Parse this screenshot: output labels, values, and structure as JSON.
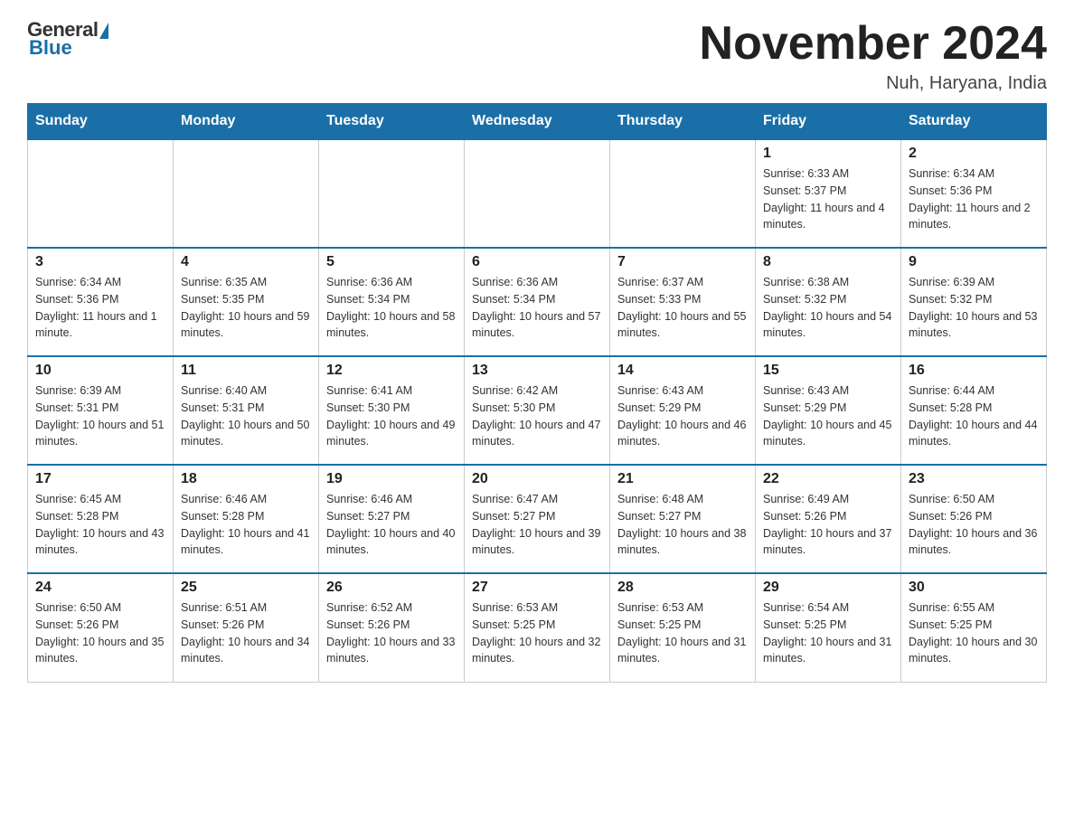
{
  "logo": {
    "general": "General",
    "blue": "Blue"
  },
  "title": "November 2024",
  "location": "Nuh, Haryana, India",
  "weekdays": [
    "Sunday",
    "Monday",
    "Tuesday",
    "Wednesday",
    "Thursday",
    "Friday",
    "Saturday"
  ],
  "weeks": [
    [
      {
        "day": "",
        "info": ""
      },
      {
        "day": "",
        "info": ""
      },
      {
        "day": "",
        "info": ""
      },
      {
        "day": "",
        "info": ""
      },
      {
        "day": "",
        "info": ""
      },
      {
        "day": "1",
        "info": "Sunrise: 6:33 AM\nSunset: 5:37 PM\nDaylight: 11 hours and 4 minutes."
      },
      {
        "day": "2",
        "info": "Sunrise: 6:34 AM\nSunset: 5:36 PM\nDaylight: 11 hours and 2 minutes."
      }
    ],
    [
      {
        "day": "3",
        "info": "Sunrise: 6:34 AM\nSunset: 5:36 PM\nDaylight: 11 hours and 1 minute."
      },
      {
        "day": "4",
        "info": "Sunrise: 6:35 AM\nSunset: 5:35 PM\nDaylight: 10 hours and 59 minutes."
      },
      {
        "day": "5",
        "info": "Sunrise: 6:36 AM\nSunset: 5:34 PM\nDaylight: 10 hours and 58 minutes."
      },
      {
        "day": "6",
        "info": "Sunrise: 6:36 AM\nSunset: 5:34 PM\nDaylight: 10 hours and 57 minutes."
      },
      {
        "day": "7",
        "info": "Sunrise: 6:37 AM\nSunset: 5:33 PM\nDaylight: 10 hours and 55 minutes."
      },
      {
        "day": "8",
        "info": "Sunrise: 6:38 AM\nSunset: 5:32 PM\nDaylight: 10 hours and 54 minutes."
      },
      {
        "day": "9",
        "info": "Sunrise: 6:39 AM\nSunset: 5:32 PM\nDaylight: 10 hours and 53 minutes."
      }
    ],
    [
      {
        "day": "10",
        "info": "Sunrise: 6:39 AM\nSunset: 5:31 PM\nDaylight: 10 hours and 51 minutes."
      },
      {
        "day": "11",
        "info": "Sunrise: 6:40 AM\nSunset: 5:31 PM\nDaylight: 10 hours and 50 minutes."
      },
      {
        "day": "12",
        "info": "Sunrise: 6:41 AM\nSunset: 5:30 PM\nDaylight: 10 hours and 49 minutes."
      },
      {
        "day": "13",
        "info": "Sunrise: 6:42 AM\nSunset: 5:30 PM\nDaylight: 10 hours and 47 minutes."
      },
      {
        "day": "14",
        "info": "Sunrise: 6:43 AM\nSunset: 5:29 PM\nDaylight: 10 hours and 46 minutes."
      },
      {
        "day": "15",
        "info": "Sunrise: 6:43 AM\nSunset: 5:29 PM\nDaylight: 10 hours and 45 minutes."
      },
      {
        "day": "16",
        "info": "Sunrise: 6:44 AM\nSunset: 5:28 PM\nDaylight: 10 hours and 44 minutes."
      }
    ],
    [
      {
        "day": "17",
        "info": "Sunrise: 6:45 AM\nSunset: 5:28 PM\nDaylight: 10 hours and 43 minutes."
      },
      {
        "day": "18",
        "info": "Sunrise: 6:46 AM\nSunset: 5:28 PM\nDaylight: 10 hours and 41 minutes."
      },
      {
        "day": "19",
        "info": "Sunrise: 6:46 AM\nSunset: 5:27 PM\nDaylight: 10 hours and 40 minutes."
      },
      {
        "day": "20",
        "info": "Sunrise: 6:47 AM\nSunset: 5:27 PM\nDaylight: 10 hours and 39 minutes."
      },
      {
        "day": "21",
        "info": "Sunrise: 6:48 AM\nSunset: 5:27 PM\nDaylight: 10 hours and 38 minutes."
      },
      {
        "day": "22",
        "info": "Sunrise: 6:49 AM\nSunset: 5:26 PM\nDaylight: 10 hours and 37 minutes."
      },
      {
        "day": "23",
        "info": "Sunrise: 6:50 AM\nSunset: 5:26 PM\nDaylight: 10 hours and 36 minutes."
      }
    ],
    [
      {
        "day": "24",
        "info": "Sunrise: 6:50 AM\nSunset: 5:26 PM\nDaylight: 10 hours and 35 minutes."
      },
      {
        "day": "25",
        "info": "Sunrise: 6:51 AM\nSunset: 5:26 PM\nDaylight: 10 hours and 34 minutes."
      },
      {
        "day": "26",
        "info": "Sunrise: 6:52 AM\nSunset: 5:26 PM\nDaylight: 10 hours and 33 minutes."
      },
      {
        "day": "27",
        "info": "Sunrise: 6:53 AM\nSunset: 5:25 PM\nDaylight: 10 hours and 32 minutes."
      },
      {
        "day": "28",
        "info": "Sunrise: 6:53 AM\nSunset: 5:25 PM\nDaylight: 10 hours and 31 minutes."
      },
      {
        "day": "29",
        "info": "Sunrise: 6:54 AM\nSunset: 5:25 PM\nDaylight: 10 hours and 31 minutes."
      },
      {
        "day": "30",
        "info": "Sunrise: 6:55 AM\nSunset: 5:25 PM\nDaylight: 10 hours and 30 minutes."
      }
    ]
  ]
}
